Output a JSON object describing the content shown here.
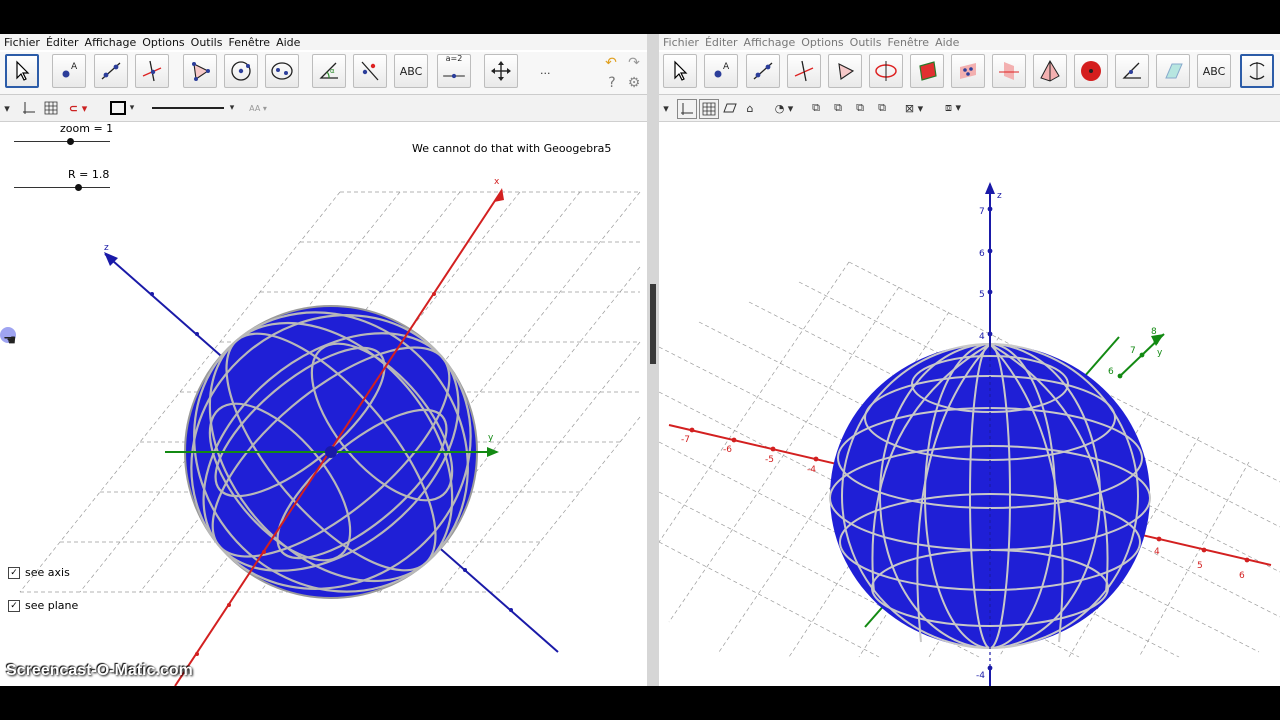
{
  "left": {
    "menu": [
      "Fichier",
      "Éditer",
      "Affichage",
      "Options",
      "Outils",
      "Fenêtre",
      "Aide"
    ],
    "toolbar": {
      "text_tool": "ABC",
      "slider_tool": "a=2",
      "more": "..."
    },
    "sliders": [
      {
        "label": "zoom = 1",
        "value": 1
      },
      {
        "label": "R = 1.8",
        "value": 1.8
      }
    ],
    "note": "We cannot do that with Geoogebra5",
    "checkboxes": [
      {
        "label": "see axis",
        "checked": true
      },
      {
        "label": "see plane",
        "checked": true
      }
    ],
    "axis_labels": {
      "x": "x",
      "y": "y",
      "z": "z"
    }
  },
  "right": {
    "menu": [
      "Fichier",
      "Éditer",
      "Affichage",
      "Options",
      "Outils",
      "Fenêtre",
      "Aide"
    ],
    "toolbar": {
      "text_tool": "ABC"
    },
    "z_ticks": [
      "7",
      "6",
      "5",
      "4",
      "-4"
    ],
    "x_ticks": [
      "-7",
      "-6",
      "-5",
      "-4"
    ],
    "x_ticks_right": [
      "4",
      "5",
      "6"
    ],
    "y_ticks": [
      "6",
      "7",
      "8"
    ],
    "axis_labels": {
      "z": "z",
      "y": "y"
    }
  },
  "watermark": "Screencast-O-Matic.com",
  "colors": {
    "sphere": "#1f1fd6",
    "x_axis": "#d32020",
    "y_axis": "#138a13",
    "z_axis": "#1a1aa8",
    "grid": "#9a9a9a"
  }
}
